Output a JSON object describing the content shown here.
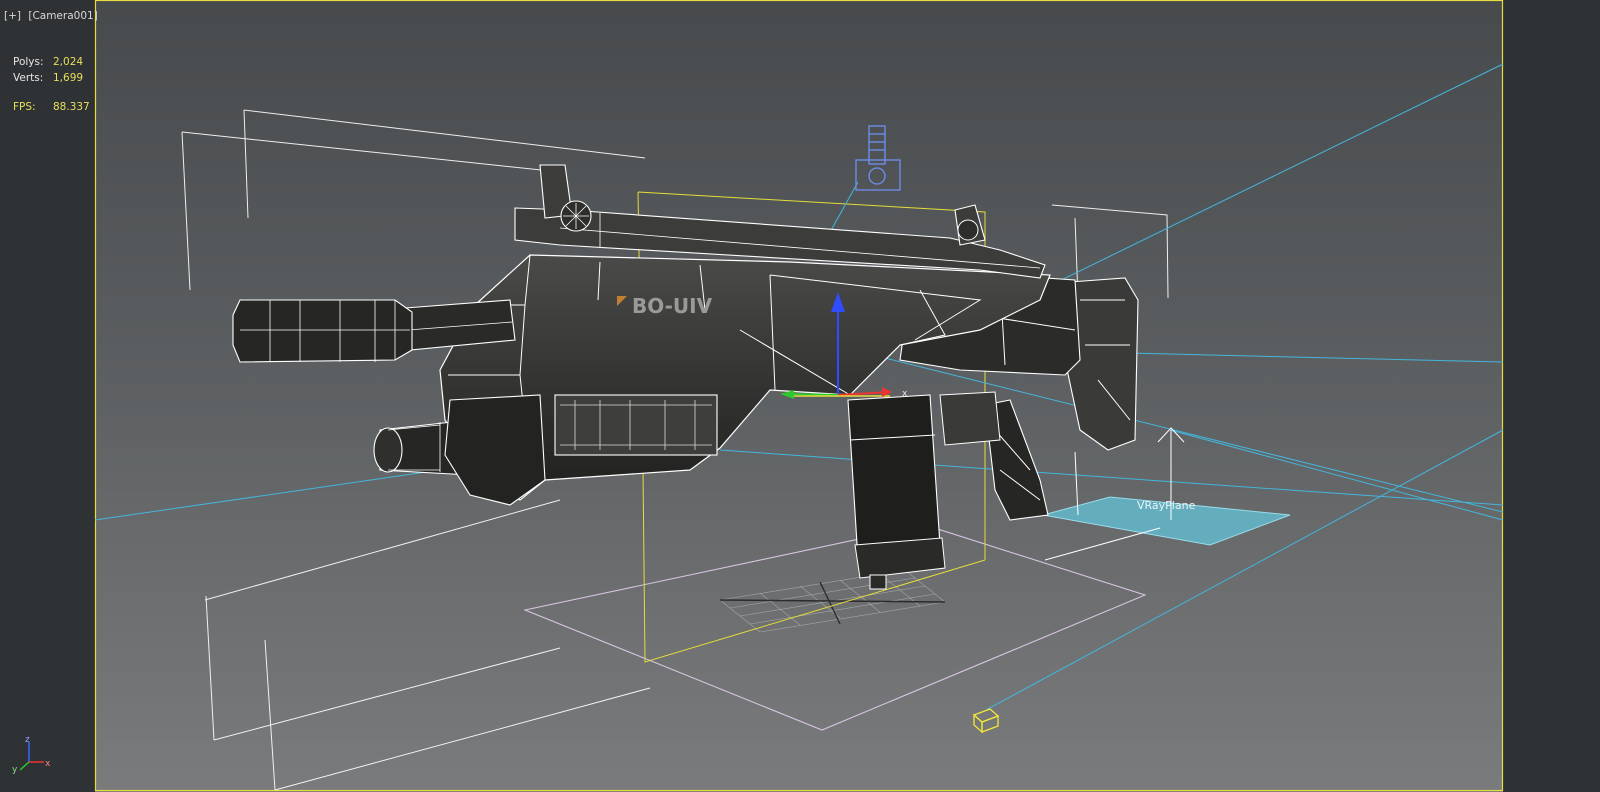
{
  "viewport": {
    "menu_label": "[+]",
    "camera_label": "[Camera001]",
    "stats": [
      {
        "key": "Polys:",
        "value": "2,024"
      },
      {
        "key": "Verts:",
        "value": "1,699"
      }
    ],
    "fps": {
      "key": "FPS:",
      "value": "88.337"
    },
    "object_label": "VRayPlane",
    "weapon_decal": "BO-UIV",
    "axis_labels": {
      "x": "x",
      "y": "y",
      "z": "z"
    }
  },
  "colors": {
    "background_top": "#4a4d4f",
    "background_bottom": "#6f7172",
    "wire": "#ffffff",
    "selection_box": "#e6dc3c",
    "light_lines": "#3fb3da",
    "ground_grid": "#c8b6d6",
    "vray_plane": "#5fc3d9",
    "stat_value": "#e8df5a"
  }
}
